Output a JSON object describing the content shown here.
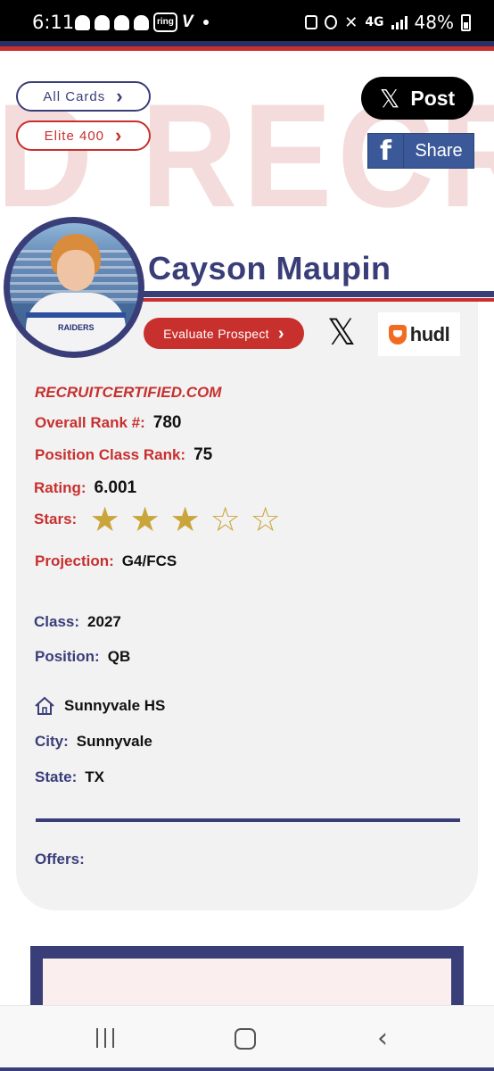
{
  "status_bar": {
    "time": "6:11",
    "network": "4G",
    "battery": "48%"
  },
  "header": {
    "all_cards_label": "All Cards",
    "elite_label": "Elite 400",
    "post_label": "Post",
    "share_label": "Share",
    "watermark_text": "D RECRUIT"
  },
  "player": {
    "name": "Cayson Maupin",
    "jersey_text": "RAIDERS"
  },
  "actions": {
    "evaluate_label": "Evaluate Prospect",
    "hudl_label": "hudl"
  },
  "profile": {
    "site": "RECRUITCERTIFIED.COM",
    "overall_rank_label": "Overall Rank #:",
    "overall_rank_value": "780",
    "position_class_rank_label": "Position Class Rank:",
    "position_class_rank_value": "75",
    "rating_label": "Rating:",
    "rating_value": "6.001",
    "stars_label": "Stars:",
    "stars_filled": 3,
    "stars_total": 5,
    "projection_label": "Projection:",
    "projection_value": "G4/FCS",
    "class_label": "Class:",
    "class_value": "2027",
    "position_label": "Position:",
    "position_value": "QB",
    "school_value": "Sunnyvale HS",
    "city_label": "City:",
    "city_value": "Sunnyvale",
    "state_label": "State:",
    "state_value": "TX",
    "offers_label": "Offers:"
  },
  "colors": {
    "navy": "#3a3e78",
    "red": "#c8302e",
    "gold": "#caa53b",
    "card_bg": "#f2f2f3"
  },
  "icons": {
    "x_logo": "x-icon",
    "facebook": "facebook-icon",
    "home": "house-icon",
    "chevron": "chevron-right-icon"
  }
}
